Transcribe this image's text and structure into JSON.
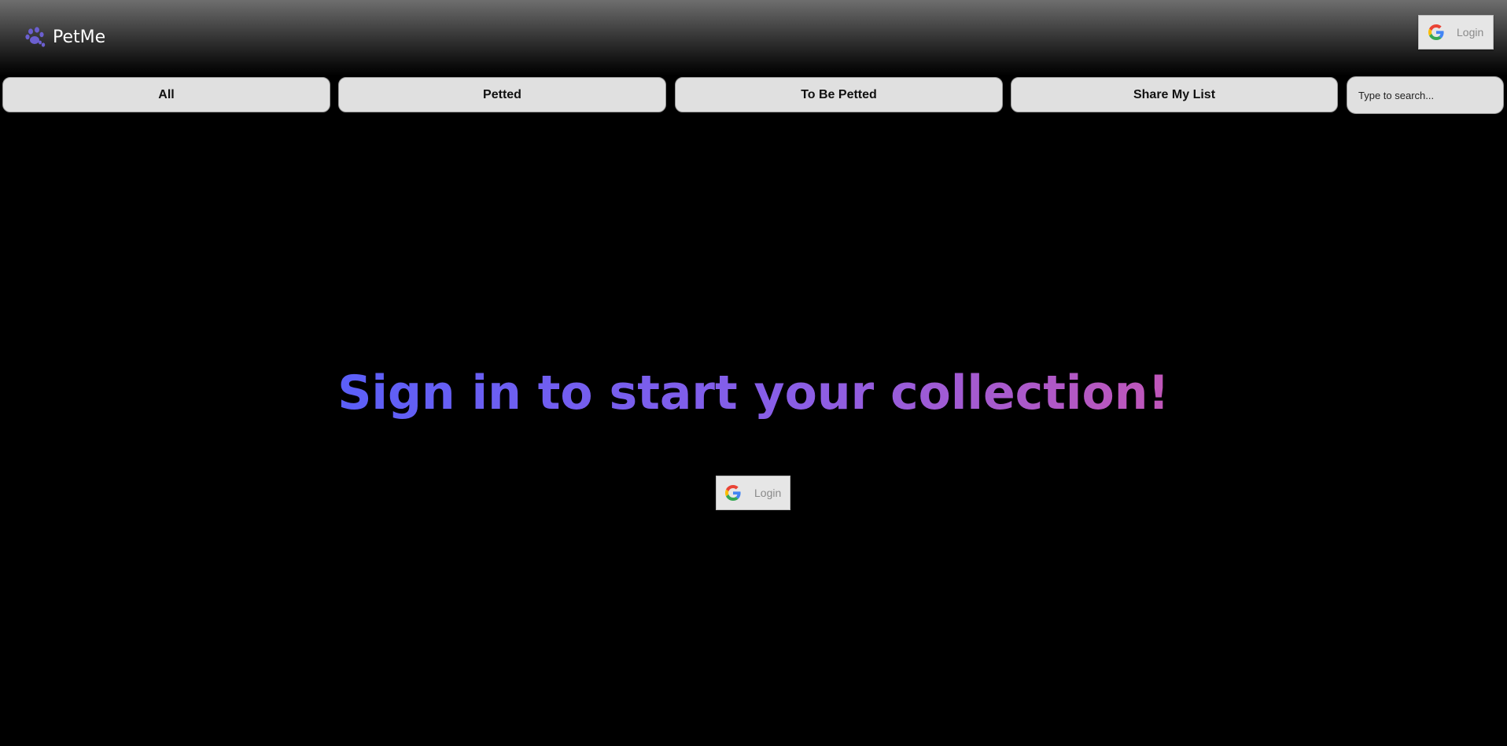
{
  "header": {
    "brand_name": "PetMe",
    "brand_icon": "paw-icon",
    "login": {
      "label": "Login",
      "icon": "google-icon"
    }
  },
  "tabs": [
    {
      "label": "All"
    },
    {
      "label": "Petted"
    },
    {
      "label": "To Be Petted"
    },
    {
      "label": "Share My List"
    }
  ],
  "search": {
    "placeholder": "Type to search..."
  },
  "main": {
    "headline": "Sign in to start your collection!",
    "login": {
      "label": "Login",
      "icon": "google-icon"
    }
  },
  "colors": {
    "background": "#000000",
    "tab_background": "#e0e0e0",
    "gradient_start": "#5b5ff8",
    "gradient_end": "#c056b8",
    "paw_icon": "#6b5fd0"
  }
}
